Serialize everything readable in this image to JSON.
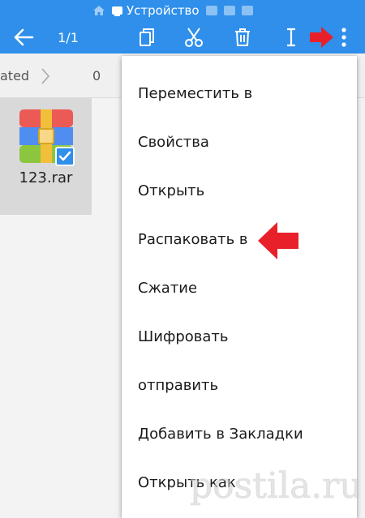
{
  "statusbar": {
    "title": "Устройство"
  },
  "toolbar": {
    "selection_count": "1/1"
  },
  "breadcrumb": {
    "left_fragment": "ated",
    "right_fragment": "0"
  },
  "file": {
    "name": "123.rar"
  },
  "menu": {
    "items": [
      "Переместить в",
      "Свойства",
      "Открыть",
      "Распаковать в",
      "Сжатие",
      "Шифровать",
      "отправить",
      "Добавить в Закладки",
      "Открыть как"
    ]
  },
  "watermark": {
    "text": "postila.ru"
  },
  "colors": {
    "toolbar": "#2f8fea",
    "arrow_red": "#e8202a",
    "selected_tile": "#d9d9d9"
  },
  "icons": {
    "back": "arrow-left-icon",
    "copy": "copy-icon",
    "cut": "scissors-icon",
    "delete": "trash-icon",
    "rename": "text-cursor-icon",
    "more": "more-vert-icon",
    "home": "home-icon"
  }
}
